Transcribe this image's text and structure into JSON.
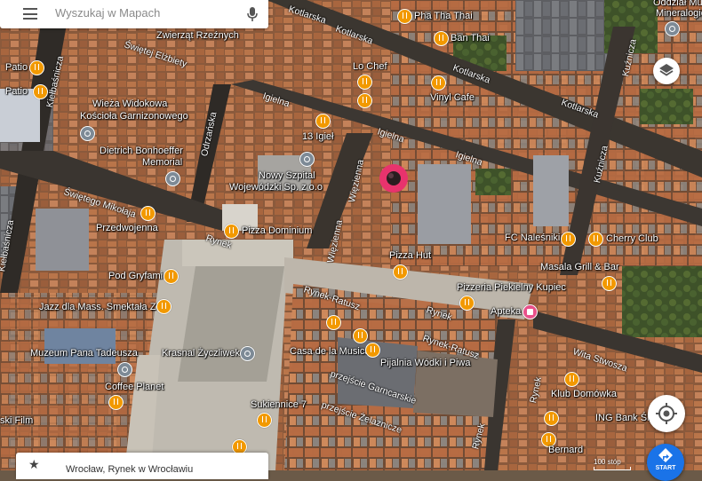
{
  "search": {
    "placeholder": "Wyszukaj w Mapach"
  },
  "bottom_card": {
    "text": "Wrocław, Rynek w Wrocławiu"
  },
  "start_button": {
    "label": "START"
  },
  "scale": {
    "label": "100 stóp"
  },
  "colors": {
    "poi_food": "#f29900",
    "poi_gray": "#7d8a96",
    "poi_shop": "#e8508a",
    "pin": "#e8336d",
    "start": "#1a73e8"
  },
  "icons": {
    "menu": "hamburger-menu-icon",
    "mic": "microphone-icon",
    "layers": "layers-icon",
    "locate": "my-location-icon",
    "start": "directions-icon",
    "pin": "map-pin-icon"
  },
  "streets": {
    "kotlarska1": "Kotlarska",
    "kotlarska2": "Kotlarska",
    "kotlarska3": "Kotlarska",
    "kotlarska4": "Kotlarska",
    "swietej_elzbiety": "Świętej Elżbiety",
    "kielbasnicza1": "Kiełbaśnicza",
    "kielbasnicza2": "Kiełbaśnicza",
    "odrzanska": "Odrzańska",
    "iglelna1": "Igielna",
    "iglelna2": "Igielna",
    "iglelna3": "Igielna",
    "wiezienna1": "Więzienna",
    "wiezienna2": "Więzienna",
    "swietego_mikolaja": "Świętego Mikołaja",
    "rynek1": "Rynek",
    "rynek_ratusz1": "Rynek-Ratusz",
    "rynek2": "Rynek",
    "rynek_ratusz2": "Rynek-Ratusz",
    "przejscie_garncarskie": "przejście Garncarskie",
    "przejscie_zelaznicze": "przejście Żelaznicze",
    "rynek3": "Rynek",
    "wita_stwosza": "Wita Stwosza",
    "kuznicza1": "Kuźnicza",
    "kuznicza2": "Kuźnicza"
  },
  "places": {
    "zwierzat_rzeznych": "Zwierząt Rzeźnych",
    "pha_tha_thai": "Pha Tha Thai",
    "ban_thai": "Ban Thai",
    "lo_chef": "Lo Chef",
    "vinyl_cafe": "Vinyl Cafe",
    "oddzial_muzeum": "Oddział Muz",
    "mineralogia": "Mineralogic",
    "patio": "Patio",
    "patio2": "Patio",
    "wieza_widokowa": "Wieża Widokowa",
    "kosciola": "Kościoła Garnizonowego",
    "dietrich": "Dietrich Bonhoeffer",
    "memorial": "Memorial",
    "13_igiel": "13 Igieł",
    "nowy_szpital": "Nowy Szpital",
    "wojewodzki": "Wojewódzki Sp. z o.o",
    "przedwojenna": "Przedwojenna",
    "pizza_dominium": "Pizza Dominium",
    "fc_nalesniki": "FC Naleśniki",
    "cherry_club": "Cherry Club",
    "masala": "Masala Grill & Bar",
    "pizza_hut": "Pizza Hut",
    "pod_gryfami": "Pod Gryfami",
    "pizzeria_piekielny": "Pizzeria Piekielny Kupiec",
    "apteka": "Apteka",
    "jazz": "Jazz dla Mass. Smektała Z",
    "muzeum_pana": "Muzeum Pana Tadeusza",
    "krasnal": "Krasnal Życzliwek",
    "casa_de_la_musica": "Casa de la Musica",
    "pijalnia": "Pijalnia Wódki i Piwa",
    "coffee_planet": "Coffee Planet",
    "klub_domowka": "Klub Domówka",
    "ing": "ING Bank Śl",
    "sukiennice": "Sukiennice 7",
    "bernard": "Bernard",
    "film": "ski Film"
  }
}
